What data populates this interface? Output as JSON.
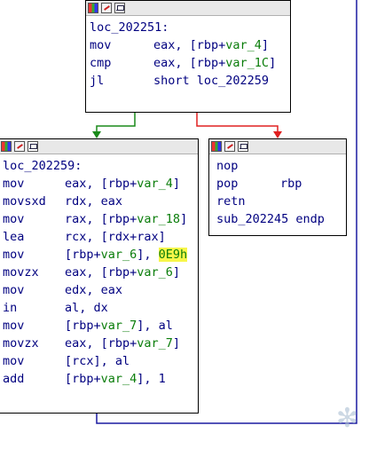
{
  "top_block": {
    "lines": [
      {
        "mnemonic": "loc_202251:",
        "operand": ""
      },
      {
        "mnemonic": "mov",
        "operand": "eax, [rbp+var_4]"
      },
      {
        "mnemonic": "cmp",
        "operand": "eax, [rbp+var_1C]"
      },
      {
        "mnemonic": "jl",
        "operand": "short loc_202259"
      }
    ]
  },
  "left_block": {
    "lines": [
      {
        "mnemonic": "loc_202259:",
        "operand": ""
      },
      {
        "mnemonic": "mov",
        "operand": "eax, [rbp+var_4]"
      },
      {
        "mnemonic": "movsxd",
        "operand": "rdx, eax"
      },
      {
        "mnemonic": "mov",
        "operand": "rax, [rbp+var_18]"
      },
      {
        "mnemonic": "lea",
        "operand": "rcx, [rdx+rax]"
      },
      {
        "mnemonic": "mov",
        "operand": "[rbp+var_6], 0E9h"
      },
      {
        "mnemonic": "movzx",
        "operand": "eax, [rbp+var_6]"
      },
      {
        "mnemonic": "mov",
        "operand": "edx, eax"
      },
      {
        "mnemonic": "in",
        "operand": "al, dx"
      },
      {
        "mnemonic": "mov",
        "operand": "[rbp+var_7], al"
      },
      {
        "mnemonic": "movzx",
        "operand": "eax, [rbp+var_7]"
      },
      {
        "mnemonic": "mov",
        "operand": "[rcx], al"
      },
      {
        "mnemonic": "add",
        "operand": "[rbp+var_4], 1"
      }
    ]
  },
  "right_block": {
    "lines": [
      {
        "mnemonic": "nop",
        "operand": ""
      },
      {
        "mnemonic": "pop",
        "operand": "rbp"
      },
      {
        "mnemonic": "retn",
        "operand": ""
      },
      {
        "mnemonic": "sub_202245 endp",
        "operand": ""
      }
    ]
  },
  "icons": [
    "node-colors-icon",
    "rename-icon",
    "graph-view-icon"
  ],
  "colors": {
    "edge_true": "#1a8a1a",
    "edge_false": "#e02020",
    "edge_loop": "#1a1aa0",
    "text": "#000080",
    "var": "#0a7d0a",
    "highlight": "#f7f64a"
  }
}
